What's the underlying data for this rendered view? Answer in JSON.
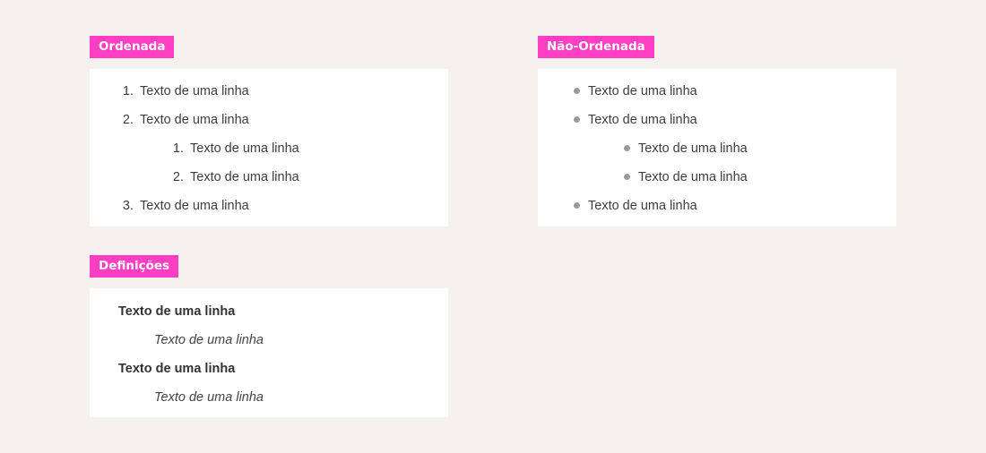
{
  "ordered": {
    "label": "Ordenada",
    "items": [
      {
        "marker": "1.",
        "text": "Texto de uma linha"
      },
      {
        "marker": "2.",
        "text": "Texto de uma linha"
      },
      {
        "marker": "1.",
        "text": "Texto de uma linha"
      },
      {
        "marker": "2.",
        "text": "Texto de uma linha"
      },
      {
        "marker": "3.",
        "text": "Texto de uma linha"
      }
    ]
  },
  "unordered": {
    "label": "Não-Ordenada",
    "items": [
      {
        "text": "Texto de uma linha"
      },
      {
        "text": "Texto de uma linha"
      },
      {
        "text": "Texto de uma linha"
      },
      {
        "text": "Texto de uma linha"
      },
      {
        "text": "Texto de uma linha"
      }
    ]
  },
  "definitions": {
    "label": "Definições",
    "items": [
      {
        "term": "Texto de uma linha",
        "description": "Texto de uma linha"
      },
      {
        "term": "Texto de uma linha",
        "description": "Texto de uma linha"
      }
    ]
  },
  "colors": {
    "accent": "#ff3ec4",
    "background": "#f5f1ef",
    "card": "#ffffff",
    "bullet": "#9b9b9b"
  },
  "icons": {
    "bullet": "bullet-dot-icon"
  }
}
